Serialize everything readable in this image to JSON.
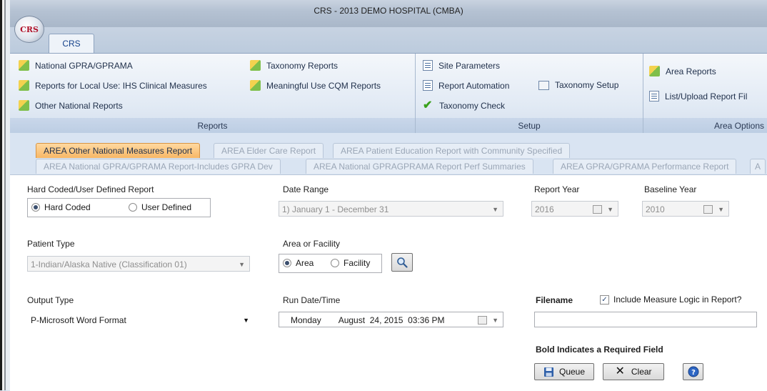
{
  "window": {
    "title": "CRS - 2013 DEMO HOSPITAL (CMBA)",
    "logo_text": "CRS"
  },
  "ribbon_tab": "CRS",
  "ribbon": {
    "reports": {
      "label": "Reports",
      "items": [
        "National GPRA/GPRAMA",
        "Reports for Local Use: IHS Clinical Measures",
        "Other National Reports",
        "Taxonomy Reports",
        "Meaningful Use CQM Reports"
      ]
    },
    "setup": {
      "label": "Setup",
      "items": [
        "Site Parameters",
        "Report Automation",
        "Taxonomy Setup",
        "Taxonomy Check"
      ]
    },
    "area_options": {
      "label": "Area Options",
      "items": [
        "Area Reports",
        "List/Upload Report Fil"
      ]
    }
  },
  "doc_tabs": {
    "row1": [
      "AREA Other National Measures Report",
      "AREA Elder Care Report",
      "AREA Patient Education Report with Community Specified"
    ],
    "row2": [
      "AREA National GPRA/GPRAMA Report-Includes GPRA Dev",
      "AREA National GPRAGPRAMA Report Perf Summaries",
      "AREA GPRA/GPRAMA Performance Report",
      "A"
    ]
  },
  "form": {
    "report_kind": {
      "label": "Hard Coded/User Defined Report",
      "opt_hard": "Hard Coded",
      "opt_user": "User Defined",
      "selected": "Hard Coded"
    },
    "date_range": {
      "label": "Date Range",
      "value": "1) January 1 - December 31"
    },
    "report_year": {
      "label": "Report Year",
      "value": "2016"
    },
    "baseline_year": {
      "label": "Baseline Year",
      "value": "2010"
    },
    "patient_type": {
      "label": "Patient Type",
      "value": "1-Indian/Alaska Native (Classification 01)"
    },
    "area_facility": {
      "label": "Area or Facility",
      "opt_area": "Area",
      "opt_facility": "Facility",
      "selected": "Area"
    },
    "output_type": {
      "label": "Output Type",
      "value": "P-Microsoft Word Format"
    },
    "run_datetime": {
      "label": "Run Date/Time",
      "day": "Monday",
      "date": "August  24, 2015  03:36 PM"
    },
    "filename": {
      "label": "Filename",
      "value": ""
    },
    "include_logic": {
      "label": "Include Measure Logic in Report?",
      "checked": true
    },
    "required_note": "Bold Indicates a Required Field",
    "queue_label": "Queue",
    "clear_label": "Clear"
  }
}
